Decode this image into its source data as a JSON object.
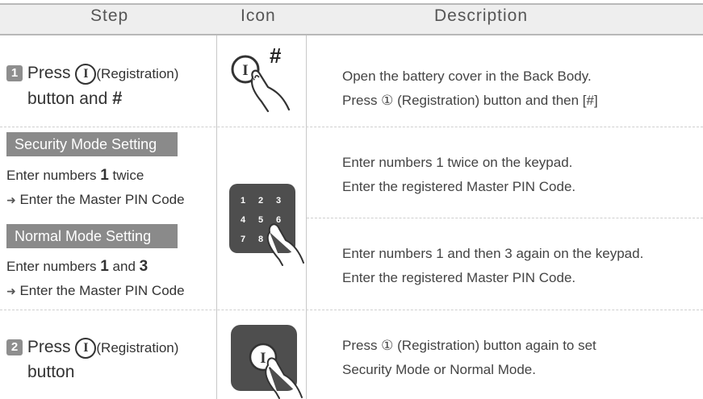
{
  "header": {
    "step": "Step",
    "icon": "Icon",
    "description": "Description"
  },
  "rows": {
    "step1": {
      "badge": "1",
      "press": "Press",
      "circle_i": "I",
      "registration": "(Registration)",
      "button_and": "button and",
      "hash_symbol": "#",
      "icon_hash": "#",
      "icon_circle_i": "I",
      "desc1": "Open the battery cover in the Back Body.",
      "desc2": "Press ① (Registration) button and then [#]"
    },
    "security": {
      "title": "Security Mode Setting",
      "line1_prefix": "Enter numbers",
      "line1_digit": "1",
      "line1_suffix": "twice",
      "line2_arrow": "➜",
      "line2": "Enter the Master PIN Code",
      "desc1": "Enter numbers 1 twice on the keypad.",
      "desc2": "Enter the registered Master PIN Code."
    },
    "normal": {
      "title": "Normal Mode Setting",
      "line1_prefix": "Enter numbers",
      "line1_digit1": "1",
      "line1_and": "and",
      "line1_digit2": "3",
      "line2_arrow": "➜",
      "line2": "Enter the Master PIN Code",
      "desc1": "Enter numbers 1 and then 3 again on the keypad.",
      "desc2": "Enter the registered Master PIN Code."
    },
    "step2": {
      "badge": "2",
      "press": "Press",
      "circle_i": "I",
      "registration": "(Registration)",
      "button": "button",
      "icon_circle_i": "I",
      "desc1": "Press ① (Registration) button again to set",
      "desc2": "Security Mode or Normal Mode."
    }
  },
  "keypad": {
    "digits": [
      "1",
      "2",
      "3",
      "4",
      "5",
      "6",
      "7",
      "8"
    ]
  }
}
